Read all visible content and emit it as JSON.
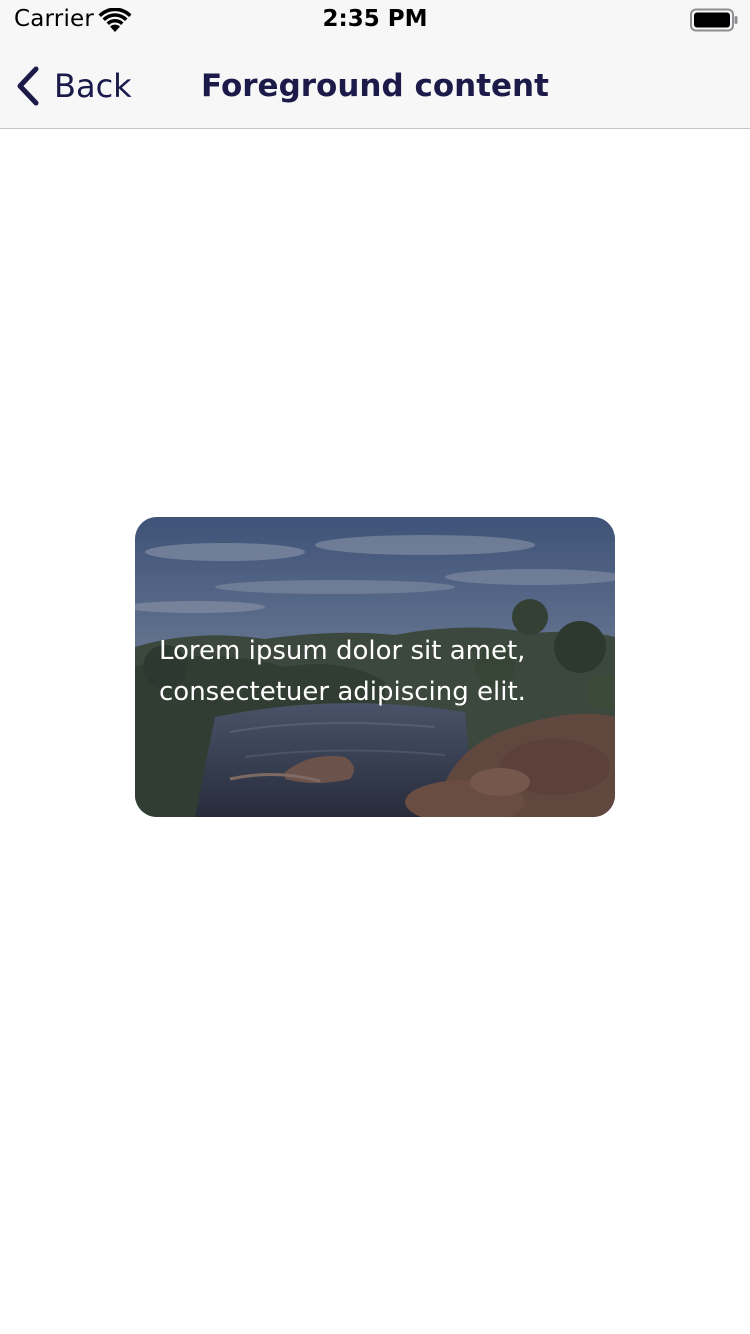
{
  "status_bar": {
    "carrier": "Carrier",
    "time": "2:35 PM",
    "wifi_icon": "wifi-icon",
    "battery_icon": "battery-full-icon"
  },
  "nav_bar": {
    "back_label": "Back",
    "back_icon": "chevron-left-icon",
    "title": "Foreground content",
    "tint_color": "#1b1a48"
  },
  "card": {
    "text": "Lorem ipsum dolor sit amet, consectetuer adipiscing elit.",
    "text_color": "#ffffff"
  }
}
